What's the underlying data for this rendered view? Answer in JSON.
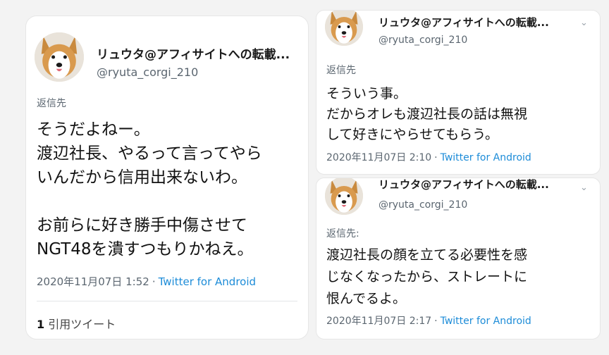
{
  "tweets": [
    {
      "display_name": "リュウタ@アフィサイトへの転載...",
      "handle": "@ryuta_corgi_210",
      "reply_label": "返信先",
      "body_lines": [
        "そうだよねー。",
        "渡辺社長、やるって言ってやら",
        "いんだから信用出来ないわ。",
        "",
        "お前らに好き勝手中傷させて",
        "NGT48を潰すつもりかねえ。"
      ],
      "timestamp": "2020年11月07日 1:52",
      "separator": "·",
      "source": "Twitter for Android",
      "quote_count": "1",
      "quote_label": "引用ツイート"
    },
    {
      "display_name": "リュウタ@アフィサイトへの転載...",
      "handle": "@ryuta_corgi_210",
      "reply_label": "返信先",
      "body_lines": [
        "そういう事。",
        "だからオレも渡辺社長の話は無視",
        "して好きにやらせてもらう。"
      ],
      "timestamp": "2020年11月07日 2:10",
      "separator": "·",
      "source": "Twitter for Android"
    },
    {
      "display_name": "リュウタ@アフィサイトへの転載...",
      "handle": "@ryuta_corgi_210",
      "reply_label": "返信先:",
      "body_lines": [
        "渡辺社長の顔を立てる必要性を感",
        "じなくなったから、ストレートに",
        "恨んでるよ。"
      ],
      "timestamp": "2020年11月07日 2:17",
      "separator": "·",
      "source": "Twitter for Android"
    }
  ],
  "icons": {
    "more": "chevron-down-icon",
    "avatar": "corgi-avatar"
  },
  "colors": {
    "source_link": "#1d8cd8",
    "muted_text": "#5b6670",
    "card_background": "#ffffff",
    "page_background": "#f3f3f3"
  }
}
